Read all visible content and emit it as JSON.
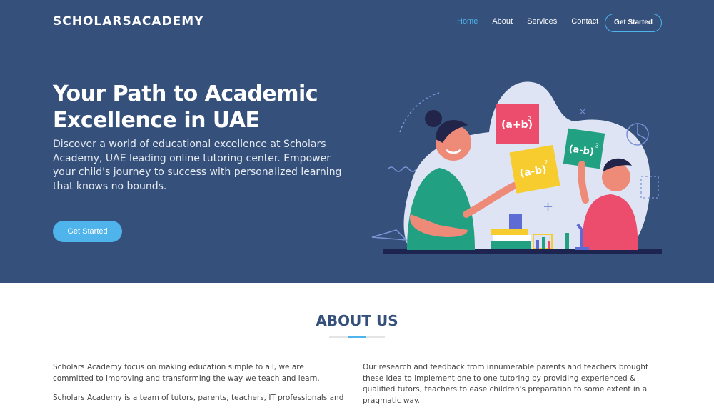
{
  "brand": "SCHOLARSACADEMY",
  "nav": {
    "items": [
      "Home",
      "About",
      "Services",
      "Contact"
    ],
    "cta": "Get Started"
  },
  "hero": {
    "title": "Your Path to Academic Excellence in UAE",
    "text": "Discover a world of educational excellence at Scholars Academy, UAE leading online tutoring center. Empower your child's journey to success with personalized learning that knows no bounds.",
    "cta": "Get Started",
    "illustration": {
      "card1": "(a+b)",
      "card1_exp": "2",
      "card2": "(a-b)",
      "card2_exp": "2",
      "card3": "(a-b)",
      "card3_exp": "3"
    }
  },
  "about": {
    "title": "ABOUT US",
    "left": [
      "Scholars Academy focus on making education simple to all, we are committed to improving and transforming the way we teach and learn.",
      "Scholars Academy is a team of tutors, parents, teachers, IT professionals and"
    ],
    "right": [
      "Our research and feedback from innumerable parents and teachers brought these idea to implement one to one tutoring by providing experienced & qualified tutors, teachers to ease children's preparation to some extent in a pragmatic way."
    ]
  },
  "colors": {
    "hero_bg": "#34507b",
    "accent": "#4fb3ec",
    "title": "#34507b"
  }
}
